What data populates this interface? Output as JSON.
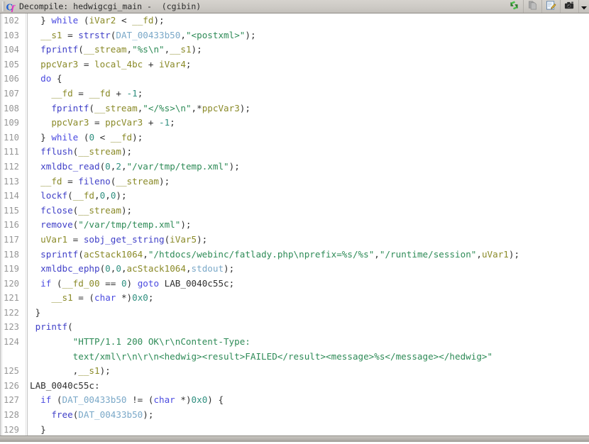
{
  "window": {
    "title": "Decompile: hedwigcgi_main -  (cgibin)",
    "icon_name": "decompiler-c-icon"
  },
  "toolbar": {
    "buttons": [
      {
        "name": "refresh-icon",
        "tooltip": "Refresh"
      },
      {
        "name": "copy-icon",
        "tooltip": "Copy"
      },
      {
        "name": "edit-icon",
        "tooltip": "Edit"
      },
      {
        "name": "camera-icon",
        "tooltip": "Snapshot"
      },
      {
        "name": "chevron-down-icon",
        "tooltip": "More"
      }
    ]
  },
  "colors": {
    "keyword": "#4a4ae0",
    "function": "#4040c8",
    "string": "#2e8b57",
    "variable": "#8a8a28",
    "global": "#7aa8c8",
    "number": "#2f8f7f",
    "plain": "#303030",
    "background": "#ffffff",
    "linenumber": "#969696",
    "titlebar": "#cecbc6"
  },
  "editor": {
    "first_line": 102,
    "last_line": 129,
    "lines": [
      {
        "n": "102",
        "tokens": [
          {
            "t": "  } ",
            "c": "plain"
          },
          {
            "t": "while",
            "c": "kw"
          },
          {
            "t": " (",
            "c": "plain"
          },
          {
            "t": "iVar2",
            "c": "var"
          },
          {
            "t": " < ",
            "c": "plain"
          },
          {
            "t": "__fd",
            "c": "var"
          },
          {
            "t": ");",
            "c": "plain"
          }
        ]
      },
      {
        "n": "103",
        "tokens": [
          {
            "t": "  ",
            "c": "plain"
          },
          {
            "t": "__s1",
            "c": "var"
          },
          {
            "t": " = ",
            "c": "plain"
          },
          {
            "t": "strstr",
            "c": "fn"
          },
          {
            "t": "(",
            "c": "plain"
          },
          {
            "t": "DAT_00433b50",
            "c": "glob"
          },
          {
            "t": ",",
            "c": "plain"
          },
          {
            "t": "\"<postxml>\"",
            "c": "str"
          },
          {
            "t": ");",
            "c": "plain"
          }
        ]
      },
      {
        "n": "104",
        "tokens": [
          {
            "t": "  ",
            "c": "plain"
          },
          {
            "t": "fprintf",
            "c": "fn"
          },
          {
            "t": "(",
            "c": "plain"
          },
          {
            "t": "__stream",
            "c": "var"
          },
          {
            "t": ",",
            "c": "plain"
          },
          {
            "t": "\"%s\\n\"",
            "c": "str"
          },
          {
            "t": ",",
            "c": "plain"
          },
          {
            "t": "__s1",
            "c": "var"
          },
          {
            "t": ");",
            "c": "plain"
          }
        ]
      },
      {
        "n": "105",
        "tokens": [
          {
            "t": "  ",
            "c": "plain"
          },
          {
            "t": "ppcVar3",
            "c": "var"
          },
          {
            "t": " = ",
            "c": "plain"
          },
          {
            "t": "local_4bc",
            "c": "var"
          },
          {
            "t": " + ",
            "c": "plain"
          },
          {
            "t": "iVar4",
            "c": "var"
          },
          {
            "t": ";",
            "c": "plain"
          }
        ]
      },
      {
        "n": "106",
        "tokens": [
          {
            "t": "  ",
            "c": "plain"
          },
          {
            "t": "do",
            "c": "kw"
          },
          {
            "t": " {",
            "c": "plain"
          }
        ]
      },
      {
        "n": "107",
        "tokens": [
          {
            "t": "    ",
            "c": "plain"
          },
          {
            "t": "__fd",
            "c": "var"
          },
          {
            "t": " = ",
            "c": "plain"
          },
          {
            "t": "__fd",
            "c": "var"
          },
          {
            "t": " + ",
            "c": "plain"
          },
          {
            "t": "-1",
            "c": "num"
          },
          {
            "t": ";",
            "c": "plain"
          }
        ]
      },
      {
        "n": "108",
        "tokens": [
          {
            "t": "    ",
            "c": "plain"
          },
          {
            "t": "fprintf",
            "c": "fn"
          },
          {
            "t": "(",
            "c": "plain"
          },
          {
            "t": "__stream",
            "c": "var"
          },
          {
            "t": ",",
            "c": "plain"
          },
          {
            "t": "\"</%s>\\n\"",
            "c": "str"
          },
          {
            "t": ",*",
            "c": "plain"
          },
          {
            "t": "ppcVar3",
            "c": "var"
          },
          {
            "t": ");",
            "c": "plain"
          }
        ]
      },
      {
        "n": "109",
        "tokens": [
          {
            "t": "    ",
            "c": "plain"
          },
          {
            "t": "ppcVar3",
            "c": "var"
          },
          {
            "t": " = ",
            "c": "plain"
          },
          {
            "t": "ppcVar3",
            "c": "var"
          },
          {
            "t": " + ",
            "c": "plain"
          },
          {
            "t": "-1",
            "c": "num"
          },
          {
            "t": ";",
            "c": "plain"
          }
        ]
      },
      {
        "n": "110",
        "tokens": [
          {
            "t": "  } ",
            "c": "plain"
          },
          {
            "t": "while",
            "c": "kw"
          },
          {
            "t": " (",
            "c": "plain"
          },
          {
            "t": "0",
            "c": "num"
          },
          {
            "t": " < ",
            "c": "plain"
          },
          {
            "t": "__fd",
            "c": "var"
          },
          {
            "t": ");",
            "c": "plain"
          }
        ]
      },
      {
        "n": "111",
        "tokens": [
          {
            "t": "  ",
            "c": "plain"
          },
          {
            "t": "fflush",
            "c": "fn"
          },
          {
            "t": "(",
            "c": "plain"
          },
          {
            "t": "__stream",
            "c": "var"
          },
          {
            "t": ");",
            "c": "plain"
          }
        ]
      },
      {
        "n": "112",
        "tokens": [
          {
            "t": "  ",
            "c": "plain"
          },
          {
            "t": "xmldbc_read",
            "c": "fn"
          },
          {
            "t": "(",
            "c": "plain"
          },
          {
            "t": "0",
            "c": "num"
          },
          {
            "t": ",",
            "c": "plain"
          },
          {
            "t": "2",
            "c": "num"
          },
          {
            "t": ",",
            "c": "plain"
          },
          {
            "t": "\"/var/tmp/temp.xml\"",
            "c": "str"
          },
          {
            "t": ");",
            "c": "plain"
          }
        ]
      },
      {
        "n": "113",
        "tokens": [
          {
            "t": "  ",
            "c": "plain"
          },
          {
            "t": "__fd",
            "c": "var"
          },
          {
            "t": " = ",
            "c": "plain"
          },
          {
            "t": "fileno",
            "c": "fn"
          },
          {
            "t": "(",
            "c": "plain"
          },
          {
            "t": "__stream",
            "c": "var"
          },
          {
            "t": ");",
            "c": "plain"
          }
        ]
      },
      {
        "n": "114",
        "tokens": [
          {
            "t": "  ",
            "c": "plain"
          },
          {
            "t": "lockf",
            "c": "fn"
          },
          {
            "t": "(",
            "c": "plain"
          },
          {
            "t": "__fd",
            "c": "var"
          },
          {
            "t": ",",
            "c": "plain"
          },
          {
            "t": "0",
            "c": "num"
          },
          {
            "t": ",",
            "c": "plain"
          },
          {
            "t": "0",
            "c": "num"
          },
          {
            "t": ");",
            "c": "plain"
          }
        ]
      },
      {
        "n": "115",
        "tokens": [
          {
            "t": "  ",
            "c": "plain"
          },
          {
            "t": "fclose",
            "c": "fn"
          },
          {
            "t": "(",
            "c": "plain"
          },
          {
            "t": "__stream",
            "c": "var"
          },
          {
            "t": ");",
            "c": "plain"
          }
        ]
      },
      {
        "n": "116",
        "tokens": [
          {
            "t": "  ",
            "c": "plain"
          },
          {
            "t": "remove",
            "c": "fn"
          },
          {
            "t": "(",
            "c": "plain"
          },
          {
            "t": "\"/var/tmp/temp.xml\"",
            "c": "str"
          },
          {
            "t": ");",
            "c": "plain"
          }
        ]
      },
      {
        "n": "117",
        "tokens": [
          {
            "t": "  ",
            "c": "plain"
          },
          {
            "t": "uVar1",
            "c": "var"
          },
          {
            "t": " = ",
            "c": "plain"
          },
          {
            "t": "sobj_get_string",
            "c": "fn"
          },
          {
            "t": "(",
            "c": "plain"
          },
          {
            "t": "iVar5",
            "c": "var"
          },
          {
            "t": ");",
            "c": "plain"
          }
        ]
      },
      {
        "n": "118",
        "tokens": [
          {
            "t": "  ",
            "c": "plain"
          },
          {
            "t": "sprintf",
            "c": "fn"
          },
          {
            "t": "(",
            "c": "plain"
          },
          {
            "t": "acStack1064",
            "c": "var"
          },
          {
            "t": ",",
            "c": "plain"
          },
          {
            "t": "\"/htdocs/webinc/fatlady.php\\nprefix=%s/%s\"",
            "c": "str"
          },
          {
            "t": ",",
            "c": "plain"
          },
          {
            "t": "\"/runtime/session\"",
            "c": "str"
          },
          {
            "t": ",",
            "c": "plain"
          },
          {
            "t": "uVar1",
            "c": "var"
          },
          {
            "t": ");",
            "c": "plain"
          }
        ]
      },
      {
        "n": "119",
        "tokens": [
          {
            "t": "  ",
            "c": "plain"
          },
          {
            "t": "xmldbc_ephp",
            "c": "fn"
          },
          {
            "t": "(",
            "c": "plain"
          },
          {
            "t": "0",
            "c": "num"
          },
          {
            "t": ",",
            "c": "plain"
          },
          {
            "t": "0",
            "c": "num"
          },
          {
            "t": ",",
            "c": "plain"
          },
          {
            "t": "acStack1064",
            "c": "var"
          },
          {
            "t": ",",
            "c": "plain"
          },
          {
            "t": "stdout",
            "c": "glob"
          },
          {
            "t": ");",
            "c": "plain"
          }
        ]
      },
      {
        "n": "120",
        "tokens": [
          {
            "t": "  ",
            "c": "plain"
          },
          {
            "t": "if",
            "c": "kw"
          },
          {
            "t": " (",
            "c": "plain"
          },
          {
            "t": "__fd_00",
            "c": "var"
          },
          {
            "t": " == ",
            "c": "plain"
          },
          {
            "t": "0",
            "c": "num"
          },
          {
            "t": ") ",
            "c": "plain"
          },
          {
            "t": "goto",
            "c": "kw"
          },
          {
            "t": " ",
            "c": "plain"
          },
          {
            "t": "LAB_0040c55c",
            "c": "lab"
          },
          {
            "t": ";",
            "c": "plain"
          }
        ]
      },
      {
        "n": "121",
        "tokens": [
          {
            "t": "    ",
            "c": "plain"
          },
          {
            "t": "__s1",
            "c": "var"
          },
          {
            "t": " = (",
            "c": "plain"
          },
          {
            "t": "char",
            "c": "type"
          },
          {
            "t": " *)",
            "c": "plain"
          },
          {
            "t": "0x0",
            "c": "num"
          },
          {
            "t": ";",
            "c": "plain"
          }
        ]
      },
      {
        "n": "122",
        "tokens": [
          {
            "t": " }",
            "c": "plain"
          }
        ]
      },
      {
        "n": "123",
        "tokens": [
          {
            "t": " ",
            "c": "plain"
          },
          {
            "t": "printf",
            "c": "fn"
          },
          {
            "t": "(",
            "c": "plain"
          }
        ]
      },
      {
        "n": "124",
        "tokens": [
          {
            "t": "        ",
            "c": "plain"
          },
          {
            "t": "\"HTTP/1.1 200 OK\\r\\nContent-Type:",
            "c": "str"
          }
        ]
      },
      {
        "n": "",
        "tokens": [
          {
            "t": "        ",
            "c": "plain"
          },
          {
            "t": "text/xml\\r\\n\\r\\n<hedwig><result>FAILED</result><message>%s</message></hedwig>\"",
            "c": "str"
          }
        ]
      },
      {
        "n": "125",
        "tokens": [
          {
            "t": "        ,",
            "c": "plain"
          },
          {
            "t": "__s1",
            "c": "var"
          },
          {
            "t": ");",
            "c": "plain"
          }
        ]
      },
      {
        "n": "126",
        "tokens": [
          {
            "t": "LAB_0040c55c:",
            "c": "lab"
          }
        ]
      },
      {
        "n": "127",
        "tokens": [
          {
            "t": "  ",
            "c": "plain"
          },
          {
            "t": "if",
            "c": "kw"
          },
          {
            "t": " (",
            "c": "plain"
          },
          {
            "t": "DAT_00433b50",
            "c": "glob"
          },
          {
            "t": " != (",
            "c": "plain"
          },
          {
            "t": "char",
            "c": "type"
          },
          {
            "t": " *)",
            "c": "plain"
          },
          {
            "t": "0x0",
            "c": "num"
          },
          {
            "t": ") {",
            "c": "plain"
          }
        ]
      },
      {
        "n": "128",
        "tokens": [
          {
            "t": "    ",
            "c": "plain"
          },
          {
            "t": "free",
            "c": "fn"
          },
          {
            "t": "(",
            "c": "plain"
          },
          {
            "t": "DAT_00433b50",
            "c": "glob"
          },
          {
            "t": ");",
            "c": "plain"
          }
        ]
      },
      {
        "n": "129",
        "tokens": [
          {
            "t": "  }",
            "c": "plain"
          }
        ]
      }
    ]
  }
}
